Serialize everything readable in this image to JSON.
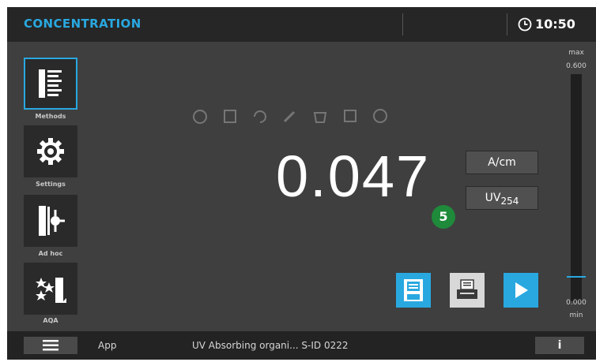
{
  "header": {
    "title": "CONCENTRATION",
    "time": "10:50"
  },
  "sidebar": {
    "items": [
      {
        "label": "Methods",
        "icon": "methods-list-icon",
        "active": true
      },
      {
        "label": "Settings",
        "icon": "gear-icon",
        "active": false
      },
      {
        "label": "Ad hoc",
        "icon": "ad-hoc-icon",
        "active": false
      },
      {
        "label": "AQA",
        "icon": "stars-aqa-icon",
        "active": false
      }
    ]
  },
  "toolbar_icons": [
    "flask-icon",
    "container-icon",
    "recycle-icon",
    "pipette-icon",
    "pot-icon",
    "edit-icon",
    "ph-icon"
  ],
  "measurement": {
    "value": "0.047",
    "unit": "A/cm",
    "parameter_main": "UV",
    "parameter_sub": "254",
    "badge": "5"
  },
  "actions": [
    {
      "name": "save-button",
      "icon": "floppy-icon"
    },
    {
      "name": "print-button",
      "icon": "printer-icon"
    },
    {
      "name": "start-button",
      "icon": "play-icon"
    }
  ],
  "scale": {
    "max_label": "max",
    "max_value": "0.600",
    "min_value": "0.000",
    "min_label": "min",
    "current_value": 0.047
  },
  "footer": {
    "app_label": "App",
    "method": "UV Absorbing organi...",
    "sid": "S-ID 0222",
    "info": "i"
  },
  "colors": {
    "accent": "#29a8e0",
    "background": "#3f3f3f",
    "header": "#262626",
    "badge": "#1e8a3a"
  }
}
